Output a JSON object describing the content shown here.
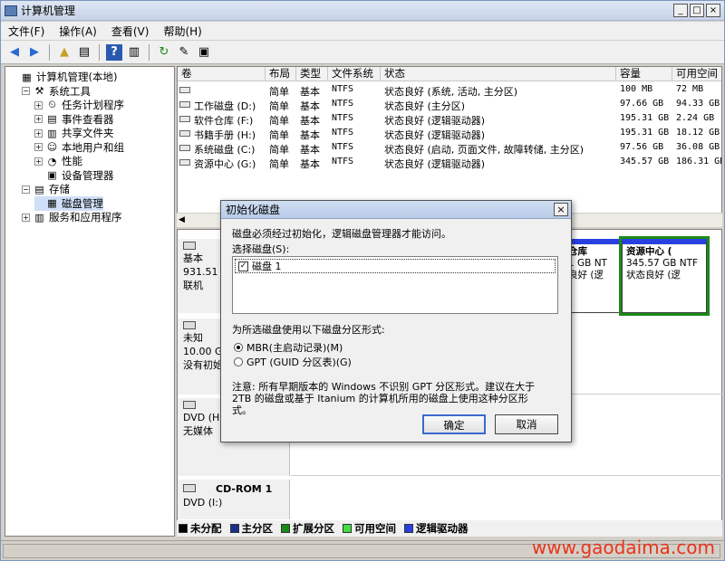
{
  "window": {
    "title": "计算机管理",
    "min": "_",
    "max": "□",
    "close": "×"
  },
  "menu": [
    "文件(F)",
    "操作(A)",
    "查看(V)",
    "帮助(H)"
  ],
  "tree": [
    {
      "label": "计算机管理(本地)",
      "indent": 0,
      "pm": ""
    },
    {
      "label": "系统工具",
      "indent": 1,
      "pm": "−"
    },
    {
      "label": "任务计划程序",
      "indent": 2,
      "pm": "+"
    },
    {
      "label": "事件查看器",
      "indent": 2,
      "pm": "+"
    },
    {
      "label": "共享文件夹",
      "indent": 2,
      "pm": "+"
    },
    {
      "label": "本地用户和组",
      "indent": 2,
      "pm": "+"
    },
    {
      "label": "性能",
      "indent": 2,
      "pm": "+"
    },
    {
      "label": "设备管理器",
      "indent": 2,
      "pm": ""
    },
    {
      "label": "存储",
      "indent": 1,
      "pm": "−"
    },
    {
      "label": "磁盘管理",
      "indent": 2,
      "pm": "",
      "selected": true
    },
    {
      "label": "服务和应用程序",
      "indent": 1,
      "pm": "+"
    }
  ],
  "columns": [
    "卷",
    "布局",
    "类型",
    "文件系统",
    "状态",
    "容量",
    "可用空间"
  ],
  "volumes": [
    {
      "name": "",
      "layout": "简单",
      "type": "基本",
      "fs": "NTFS",
      "status": "状态良好 (系统, 活动, 主分区)",
      "cap": "100 MB",
      "free": "72 MB"
    },
    {
      "name": "工作磁盘 (D:)",
      "layout": "简单",
      "type": "基本",
      "fs": "NTFS",
      "status": "状态良好 (主分区)",
      "cap": "97.66 GB",
      "free": "94.33 GB"
    },
    {
      "name": "软件仓库 (F:)",
      "layout": "简单",
      "type": "基本",
      "fs": "NTFS",
      "status": "状态良好 (逻辑驱动器)",
      "cap": "195.31 GB",
      "free": "2.24 GB"
    },
    {
      "name": "书籍手册 (H:)",
      "layout": "简单",
      "type": "基本",
      "fs": "NTFS",
      "status": "状态良好 (逻辑驱动器)",
      "cap": "195.31 GB",
      "free": "18.12 GB"
    },
    {
      "name": "系统磁盘 (C:)",
      "layout": "简单",
      "type": "基本",
      "fs": "NTFS",
      "status": "状态良好 (启动, 页面文件, 故障转储, 主分区)",
      "cap": "97.56 GB",
      "free": "36.08 GB"
    },
    {
      "name": "资源中心 (G:)",
      "layout": "简单",
      "type": "基本",
      "fs": "NTFS",
      "status": "状态良好 (逻辑驱动器)",
      "cap": "345.57 GB",
      "free": "186.31 GB"
    }
  ],
  "disks": {
    "d0": {
      "l1": "基本",
      "l2": "931.51",
      "l3": "联机"
    },
    "d1": {
      "l1": "未知",
      "l2": "10.00 G",
      "l3": "没有初始"
    },
    "d2": {
      "l1": "DVD (H:",
      "l2": "",
      "l3": "无媒体"
    },
    "d3": {
      "l1": "CD-ROM 1",
      "l2": "DVD (I:)"
    }
  },
  "parts": {
    "p1": {
      "t": "仓库",
      "s": "1 GB NT",
      "st": "良好 (逻"
    },
    "p2": {
      "t": "资源中心 (",
      "s": "345.57 GB NTF",
      "st": "状态良好 (逻"
    }
  },
  "legend": [
    {
      "label": "未分配",
      "color": "#000000"
    },
    {
      "label": "主分区",
      "color": "#1a2f8c"
    },
    {
      "label": "扩展分区",
      "color": "#1a8a1a"
    },
    {
      "label": "可用空间",
      "color": "#3fe03f"
    },
    {
      "label": "逻辑驱动器",
      "color": "#2a3fe0"
    }
  ],
  "dialog": {
    "title": "初始化磁盘",
    "intro": "磁盘必须经过初始化，逻辑磁盘管理器才能访问。",
    "select_label": "选择磁盘(S):",
    "disk_item": "磁盘 1",
    "style_label": "为所选磁盘使用以下磁盘分区形式:",
    "mbr": "MBR(主启动记录)(M)",
    "gpt": "GPT (GUID 分区表)(G)",
    "note1": "注意: 所有早期版本的 Windows 不识别 GPT 分区形式。建议在大于",
    "note2": "2TB 的磁盘或基于 Itanium 的计算机所用的磁盘上使用这种分区形",
    "note3": "式。",
    "ok": "确定",
    "cancel": "取消",
    "close": "×"
  },
  "watermark": "www.gaodaima.com"
}
